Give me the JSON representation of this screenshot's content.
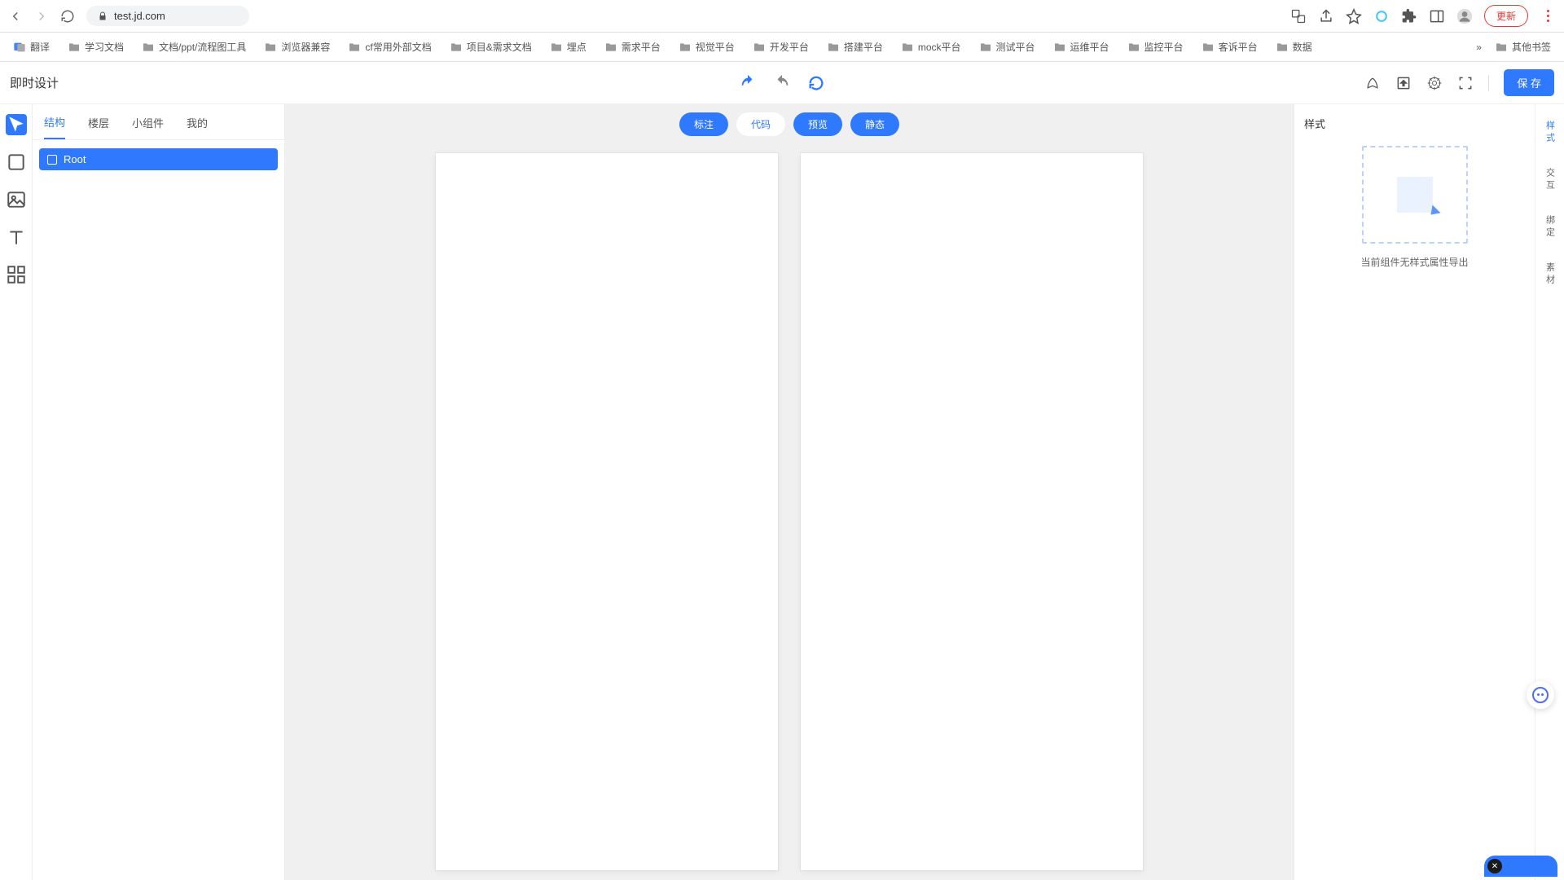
{
  "browser": {
    "url": "test.jd.com",
    "update_label": "更新",
    "bookmarks": [
      "翻译",
      "学习文档",
      "文档/ppt/流程图工具",
      "浏览器兼容",
      "cf常用外部文档",
      "项目&需求文档",
      "埋点",
      "需求平台",
      "视觉平台",
      "开发平台",
      "搭建平台",
      "mock平台",
      "测试平台",
      "运维平台",
      "监控平台",
      "客诉平台",
      "数据"
    ],
    "overflow_bookmark": "其他书签"
  },
  "app": {
    "title": "即时设计",
    "save_label": "保 存"
  },
  "left_panel": {
    "tabs": [
      "结构",
      "楼层",
      "小组件",
      "我的"
    ],
    "active_tab_index": 0,
    "tree_root_label": "Root"
  },
  "canvas": {
    "view_tabs": [
      "标注",
      "代码",
      "预览",
      "静态"
    ],
    "ghost_index": 1
  },
  "right_panel": {
    "title": "样式",
    "empty_text": "当前组件无样式属性导出"
  },
  "right_rail": {
    "items": [
      "样式",
      "交互",
      "绑定",
      "素材"
    ],
    "active_index": 0
  }
}
